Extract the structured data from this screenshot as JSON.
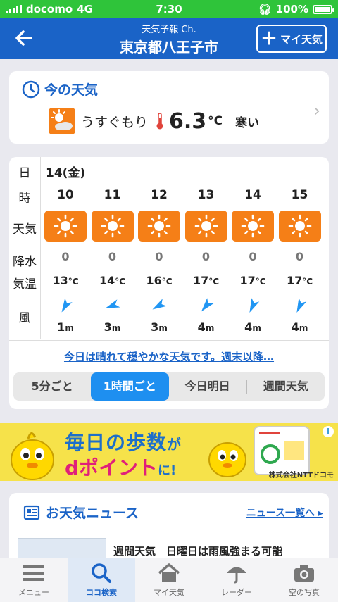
{
  "status": {
    "carrier": "docomo",
    "network": "4G",
    "time": "7:30",
    "battery": "100%"
  },
  "header": {
    "subtitle": "天気予報 Ch.",
    "title": "東京都八王子市",
    "my_weather_button": "マイ天気",
    "back_icon": "back-arrow-icon"
  },
  "current": {
    "heading": "今の天気",
    "condition": "うすぐもり",
    "temperature": "6.3",
    "unit": "°C",
    "feel": "寒い"
  },
  "hourly": {
    "labels": {
      "day": "日",
      "hour": "時",
      "weather": "天気",
      "precip": "降水",
      "temp": "気温",
      "wind": "風"
    },
    "date": "14(金)",
    "hours": [
      {
        "hour": "10",
        "precip": "0",
        "temp": "13",
        "temp_unit": "°C",
        "wind": "1",
        "wind_unit": "m",
        "wind_dir_deg": 210
      },
      {
        "hour": "11",
        "precip": "0",
        "temp": "14",
        "temp_unit": "°C",
        "wind": "3",
        "wind_unit": "m",
        "wind_dir_deg": 250
      },
      {
        "hour": "12",
        "precip": "0",
        "temp": "16",
        "temp_unit": "°C",
        "wind": "3",
        "wind_unit": "m",
        "wind_dir_deg": 240
      },
      {
        "hour": "13",
        "precip": "0",
        "temp": "17",
        "temp_unit": "°C",
        "wind": "4",
        "wind_unit": "m",
        "wind_dir_deg": 220
      },
      {
        "hour": "14",
        "precip": "0",
        "temp": "17",
        "temp_unit": "°C",
        "wind": "4",
        "wind_unit": "m",
        "wind_dir_deg": 205
      },
      {
        "hour": "15",
        "precip": "0",
        "temp": "17",
        "temp_unit": "°C",
        "wind": "4",
        "wind_unit": "m",
        "wind_dir_deg": 205
      }
    ],
    "summary": "今日は晴れて穏やかな天気です。週末以降…",
    "segments": [
      "5分ごと",
      "1時間ごと",
      "今日明日",
      "週間天気"
    ]
  },
  "ad": {
    "line1": "毎日の歩数",
    "line1_suffix": "が",
    "line2": "dポイント",
    "line2_suffix": "に!",
    "company": "株式会社NTTドコモ",
    "info": "i"
  },
  "news": {
    "heading": "お天気ニュース",
    "list_link": "ニュース一覧へ",
    "first_title": "週間天気　日曜日は雨風強まる可能"
  },
  "tabs": [
    {
      "label": "メニュー",
      "icon": "menu-icon"
    },
    {
      "label": "ココ検索",
      "icon": "search-icon"
    },
    {
      "label": "マイ天気",
      "icon": "home-icon"
    },
    {
      "label": "レーダー",
      "icon": "umbrella-icon"
    },
    {
      "label": "空の写真",
      "icon": "camera-icon"
    }
  ],
  "colors": {
    "accent": "#1a63c7",
    "sun_tile": "#f57f17",
    "status_bar": "#2fc43a",
    "active_segment": "#1e8ff0"
  }
}
